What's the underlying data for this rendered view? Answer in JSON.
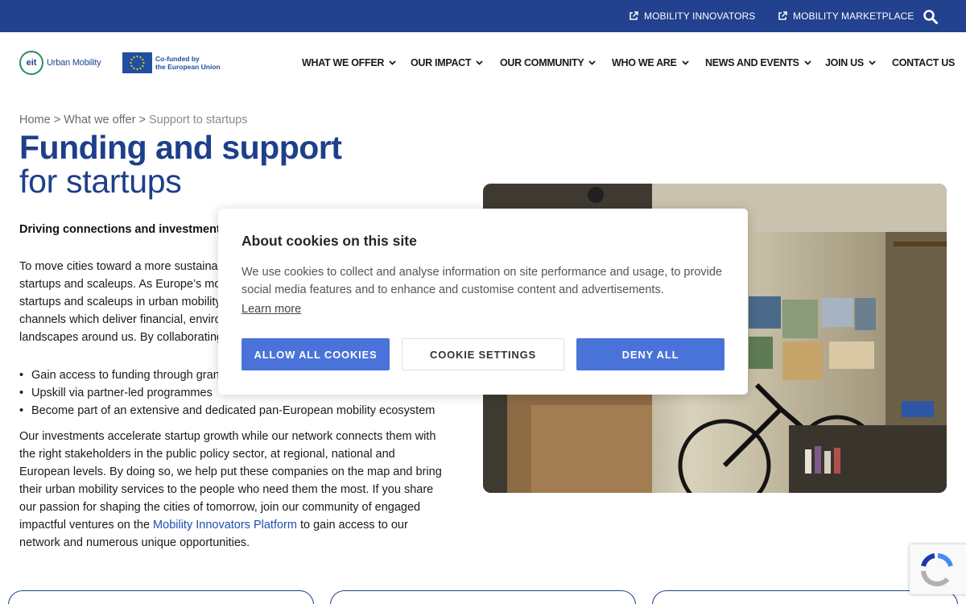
{
  "topbar": {
    "innovators": "MOBILITY INNOVATORS",
    "marketplace": "MOBILITY MARKETPLACE"
  },
  "header": {
    "logo_mark": "eit",
    "logo_text": "Urban Mobility",
    "eu_line1": "Co-funded by",
    "eu_line2": "the European Union"
  },
  "nav": {
    "items": [
      "WHAT WE OFFER",
      "OUR IMPACT",
      "OUR COMMUNITY",
      "WHO WE ARE",
      "NEWS AND EVENTS",
      "JOIN US",
      "CONTACT US"
    ]
  },
  "breadcrumb": {
    "home": "Home",
    "sep1": ">",
    "offer": "What we offer",
    "sep2": ">",
    "current": "Support to startups"
  },
  "page": {
    "title_bold": "Funding and support",
    "title_light": "for startups",
    "lead": "Driving connections and investments",
    "p1_lines": [
      "To move cities toward a more sustainab",
      "startups and scaleups. As Europe’s mos",
      "startups and scaleups in urban mobility,",
      "channels which deliver financial, environ",
      "landscapes around us. By collaborating v"
    ],
    "bullets": [
      "Gain access to funding through grants",
      "Upskill via partner-led programmes",
      "Become part of an extensive and dedicated pan-European mobility ecosystem"
    ],
    "p2_before": "Our investments accelerate startup growth while our network connects them with the right stakeholders in the public policy sector, at regional, national and European levels. By doing so, we help put these companies on the map and bring their urban mobility services to the people who need them the most. If you share our passion for shaping the cities of tomorrow, join our community of engaged impactful ventures on the ",
    "p2_link": "Mobility Innovators Platform",
    "p2_after": " to gain access to our network and numerous unique opportunities."
  },
  "cookie": {
    "title": "About cookies on this site",
    "description": "We use cookies to collect and analyse information on site performance and usage, to provide social media features and to enhance and customise content and advertisements.",
    "learn_more": "Learn more",
    "allow": "ALLOW ALL COOKIES",
    "settings": "COOKIE SETTINGS",
    "deny": "DENY ALL"
  },
  "colors": {
    "brand_blue": "#22418f",
    "title_blue": "#1e3f8a",
    "button_blue": "#4a73d9",
    "link_blue": "#1e4fb0"
  }
}
